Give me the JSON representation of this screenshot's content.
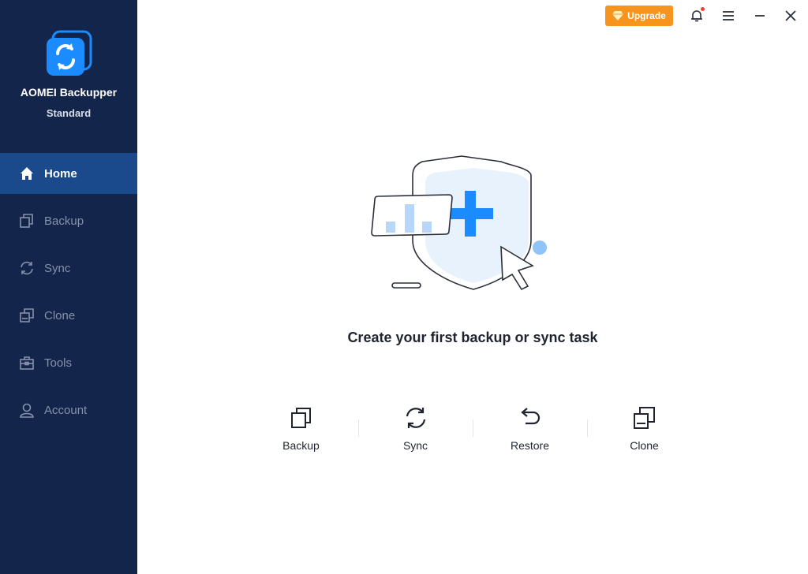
{
  "app": {
    "name": "AOMEI Backupper",
    "edition": "Standard",
    "brand_color": "#1a8cff",
    "sidebar_bg": "#13254a",
    "active_bg": "#1a4a8c"
  },
  "nav": {
    "items": [
      {
        "label": "Home",
        "icon": "home-icon",
        "active": true
      },
      {
        "label": "Backup",
        "icon": "backup-icon",
        "active": false
      },
      {
        "label": "Sync",
        "icon": "sync-icon",
        "active": false
      },
      {
        "label": "Clone",
        "icon": "clone-icon",
        "active": false
      },
      {
        "label": "Tools",
        "icon": "tools-icon",
        "active": false
      },
      {
        "label": "Account",
        "icon": "account-icon",
        "active": false
      }
    ]
  },
  "titlebar": {
    "upgrade_label": "Upgrade",
    "upgrade_color": "#f7941d",
    "icons": [
      "bell-icon",
      "menu-icon",
      "minimize-icon",
      "close-icon"
    ]
  },
  "main": {
    "headline": "Create your first backup or sync task",
    "actions": [
      {
        "label": "Backup",
        "icon": "backup-icon"
      },
      {
        "label": "Sync",
        "icon": "sync-icon"
      },
      {
        "label": "Restore",
        "icon": "restore-icon"
      },
      {
        "label": "Clone",
        "icon": "clone-icon"
      }
    ]
  }
}
